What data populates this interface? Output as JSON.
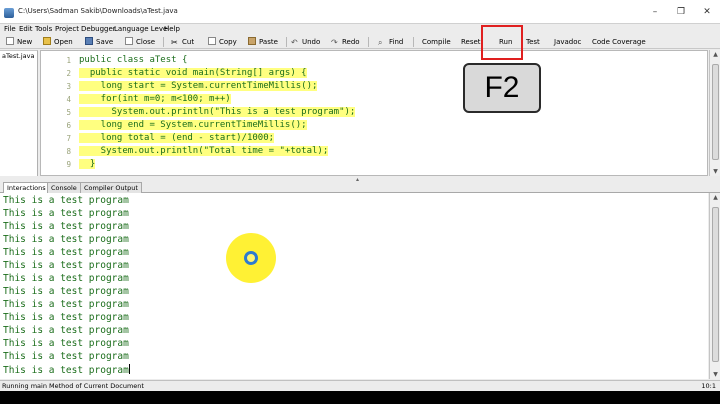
{
  "window": {
    "title": "C:\\Users\\Sadman Sakib\\Downloads\\aTest.java",
    "controls": [
      "–",
      "❐",
      "✕"
    ]
  },
  "menu": [
    "File",
    "Edit",
    "Tools",
    "Project",
    "Debugger",
    "Language Level",
    "Help"
  ],
  "toolbar": {
    "new": "New",
    "open": "Open",
    "save": "Save",
    "close": "Close",
    "cut": "Cut",
    "copy": "Copy",
    "paste": "Paste",
    "undo": "Undo",
    "redo": "Redo",
    "find": "Find",
    "compile": "Compile",
    "reset": "Reset",
    "run": "Run",
    "test": "Test",
    "javadoc": "Javadoc",
    "coverage": "Code Coverage"
  },
  "files": [
    "aTest.java"
  ],
  "editor": {
    "line_numbers": [
      "1",
      "2",
      "3",
      "4",
      "5",
      "6",
      "7",
      "8",
      "9"
    ],
    "lines": [
      "public class aTest {",
      "  public static void main(String[] args) {",
      "    long start = System.currentTimeMillis();",
      "    for(int m=0; m<100; m++)",
      "      System.out.println(\"This is a test program\");",
      "    long end = System.currentTimeMillis();",
      "    long total = (end - start)/1000;",
      "    System.out.println(\"Total time = \"+total);",
      "  }"
    ]
  },
  "tabs": [
    "Interactions",
    "Console",
    "Compiler Output"
  ],
  "console": {
    "lines": [
      "This is a test program",
      "This is a test program",
      "This is a test program",
      "This is a test program",
      "This is a test program",
      "This is a test program",
      "This is a test program",
      "This is a test program",
      "This is a test program",
      "This is a test program",
      "This is a test program",
      "This is a test program",
      "This is a test program",
      "This is a test program"
    ]
  },
  "status": {
    "message": "Running main Method of Current Document",
    "position": "10:1"
  },
  "overlay": {
    "key_label": "F2"
  },
  "colors": {
    "code_green": "#1c6e1c",
    "highlight_yellow": "#ffff80",
    "run_box_red": "#e02020",
    "cursor_halo": "#fff01e",
    "cursor_ring": "#2e7bd0"
  }
}
